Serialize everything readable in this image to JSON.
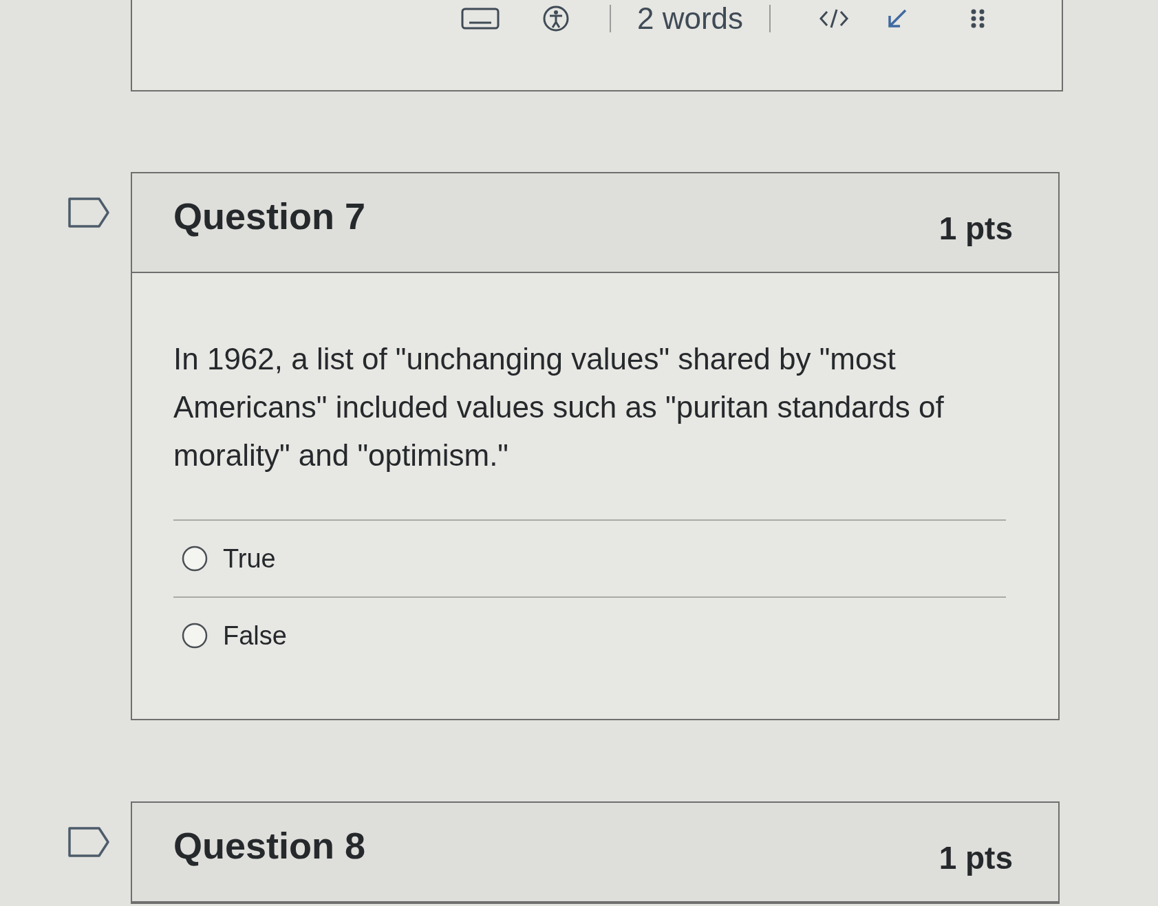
{
  "answer_box": {
    "word_count": "2 words"
  },
  "questions": [
    {
      "title": "Question 7",
      "points": "1 pts",
      "flagged": false,
      "prompt": "In 1962, a list of \"unchanging values\" shared by \"most Americans\" included values such as \"puritan standards of morality\" and \"optimism.\"",
      "answers": [
        {
          "label": "True",
          "selected": false
        },
        {
          "label": "False",
          "selected": false
        }
      ]
    },
    {
      "title": "Question 8",
      "points": "1 pts",
      "flagged": false
    }
  ]
}
